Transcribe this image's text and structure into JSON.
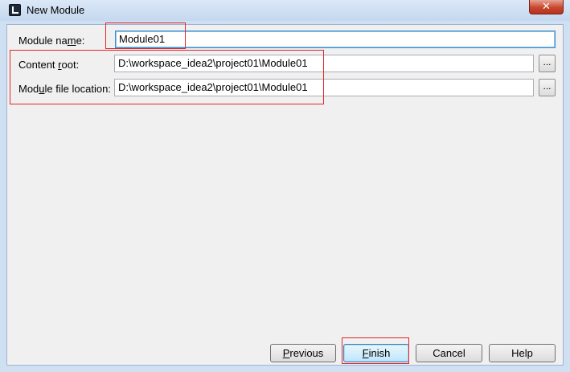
{
  "window": {
    "title": "New Module",
    "close_glyph": "✕"
  },
  "form": {
    "module_name": {
      "label_pre": "Module na",
      "label_accel": "m",
      "label_post": "e:",
      "value": "Module01"
    },
    "content_root": {
      "label_pre": "Content ",
      "label_accel": "r",
      "label_post": "oot:",
      "value": "D:\\workspace_idea2\\project01\\Module01",
      "browse_label": "..."
    },
    "module_file_location": {
      "label_pre": "Mod",
      "label_accel": "u",
      "label_post": "le file location:",
      "value": "D:\\workspace_idea2\\project01\\Module01",
      "browse_label": "..."
    }
  },
  "buttons": {
    "previous": {
      "accel": "P",
      "rest": "revious"
    },
    "finish": {
      "accel": "F",
      "rest": "inish"
    },
    "cancel": {
      "label": "Cancel"
    },
    "help": {
      "label": "Help"
    }
  },
  "colors": {
    "highlight": "#e0262b",
    "focus_border": "#3b8fd0",
    "title_bar": "#cfe0f3"
  }
}
